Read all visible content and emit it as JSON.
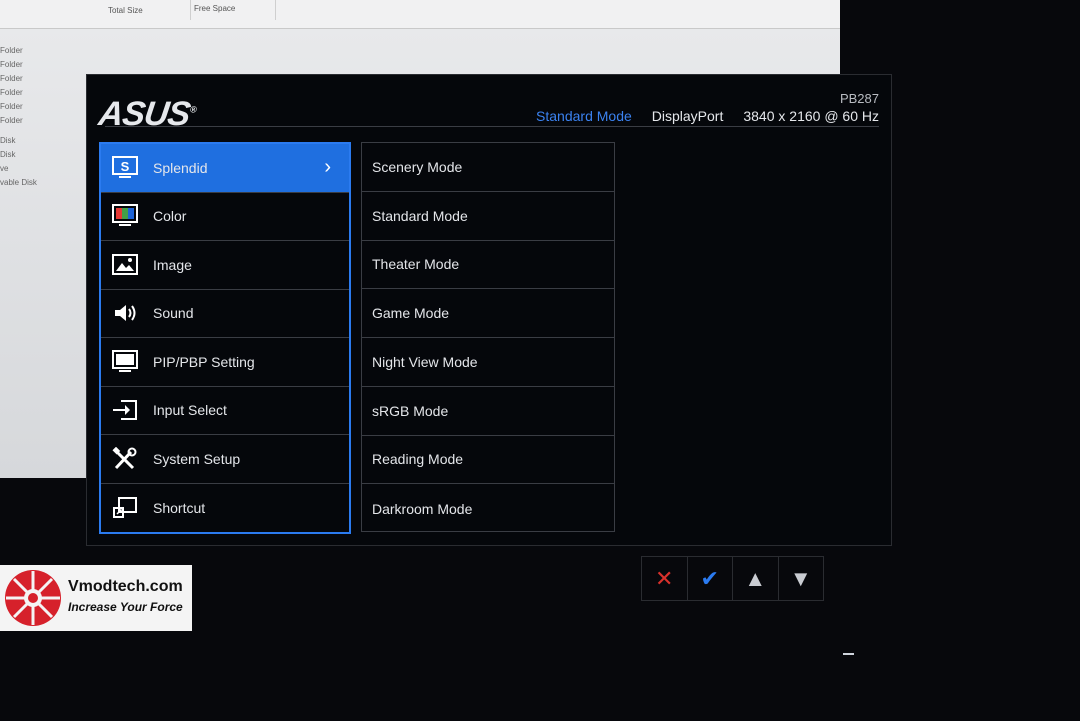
{
  "background_window": {
    "columns": [
      "Total Size",
      "Free Space"
    ],
    "rows": [
      "Folder",
      "Folder",
      "Folder",
      "Folder",
      "Folder",
      "Folder",
      "Disk",
      "Disk",
      "ve",
      "vable Disk"
    ]
  },
  "osd": {
    "brand": "ASUS",
    "model": "PB287",
    "current_mode": "Standard Mode",
    "input": "DisplayPort",
    "resolution": "3840 x 2160 @ 60 Hz",
    "menu": [
      {
        "label": "Splendid",
        "icon": "splendid-icon",
        "active": true
      },
      {
        "label": "Color",
        "icon": "color-icon"
      },
      {
        "label": "Image",
        "icon": "image-icon"
      },
      {
        "label": "Sound",
        "icon": "speaker-icon"
      },
      {
        "label": "PIP/PBP Setting",
        "icon": "pip-icon"
      },
      {
        "label": "Input Select",
        "icon": "input-icon"
      },
      {
        "label": "System Setup",
        "icon": "tools-icon"
      },
      {
        "label": "Shortcut",
        "icon": "shortcut-icon"
      }
    ],
    "submenu": [
      "Scenery Mode",
      "Standard Mode",
      "Theater Mode",
      "Game Mode",
      "Night View Mode",
      "sRGB Mode",
      "Reading Mode",
      "Darkroom Mode"
    ],
    "colors": {
      "accent": "#1f6fe0",
      "text": "#e4e6ea",
      "border": "#3a3d44"
    }
  },
  "keys": [
    {
      "icon": "close-icon",
      "glyph": "✕",
      "color": "#d8312c"
    },
    {
      "icon": "check-icon",
      "glyph": "✔",
      "color": "#2b7bf0"
    },
    {
      "icon": "up-arrow-icon",
      "glyph": "▲",
      "color": "#c9ccd2"
    },
    {
      "icon": "down-arrow-icon",
      "glyph": "▼",
      "color": "#c9ccd2"
    }
  ],
  "watermark": {
    "name": "Vmodtech.com",
    "tagline": "Increase Your Force"
  }
}
